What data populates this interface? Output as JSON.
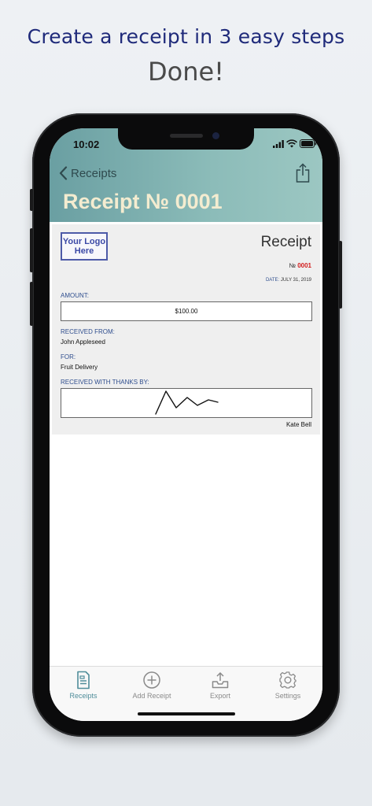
{
  "headline": {
    "line1": "Create a receipt in 3 easy steps",
    "line2": "Done!"
  },
  "status_bar": {
    "time": "10:02",
    "icons": [
      "signal-icon",
      "wifi-icon",
      "battery-icon"
    ]
  },
  "nav": {
    "back_label": "Receipts",
    "title": "Receipt № 0001",
    "share_icon": "share-icon"
  },
  "receipt": {
    "logo_text": "Your Logo Here",
    "heading": "Receipt",
    "number_prefix": "№",
    "number": "0001",
    "date_label": "DATE:",
    "date_value": "JULY 31, 2019",
    "amount_label": "AMOUNT:",
    "amount_value": "$100.00",
    "received_from_label": "RECEIVED FROM:",
    "received_from_value": "John Appleseed",
    "for_label": "FOR:",
    "for_value": "Fruit Delivery",
    "thanks_label": "RECEIVED WITH THANKS BY:",
    "signer": "Kate Bell"
  },
  "tabs": [
    {
      "label": "Receipts",
      "icon": "receipt-icon",
      "active": true
    },
    {
      "label": "Add Receipt",
      "icon": "add-circle-icon",
      "active": false
    },
    {
      "label": "Export",
      "icon": "export-tray-icon",
      "active": false
    },
    {
      "label": "Settings",
      "icon": "gear-icon",
      "active": false
    }
  ],
  "colors": {
    "headline_blue": "#1f2a7a",
    "header_teal": "#8cbcb9",
    "title_cream": "#f4ecd0",
    "label_blue": "#2f4e8e",
    "number_red": "#d21d1d",
    "tab_active": "#4f8d9a",
    "tab_inactive": "#8a8a8a"
  }
}
